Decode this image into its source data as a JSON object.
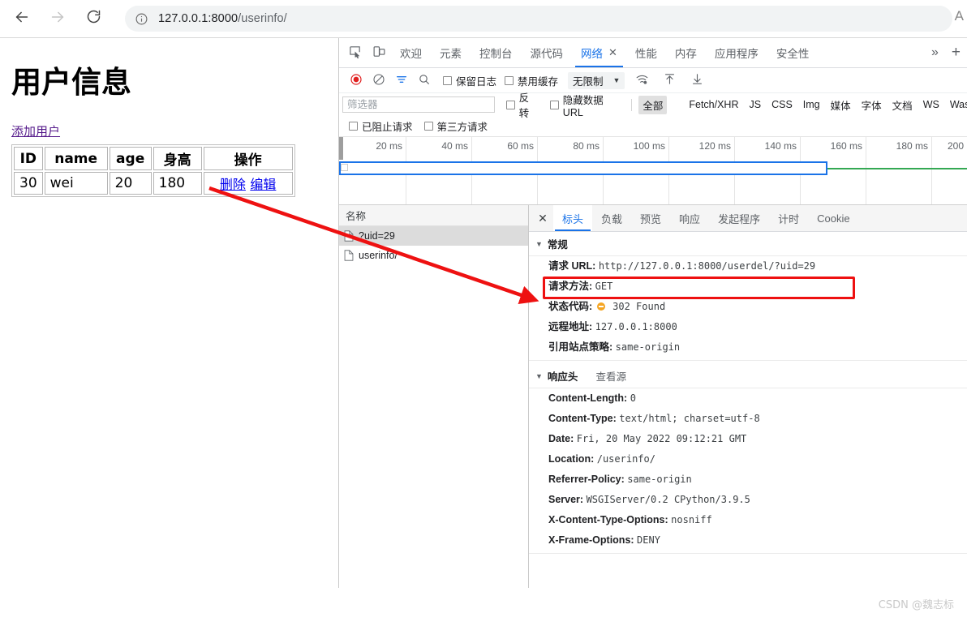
{
  "browser": {
    "back_icon": "arrow-left-icon",
    "forward_icon": "arrow-right-icon",
    "reload_icon": "reload-icon",
    "info_icon": "info-circle-icon",
    "url": "127.0.0.1:8000/userinfo/",
    "url_host": "127.0.0.1:8000",
    "url_path": "/userinfo/",
    "profile_letter": "A"
  },
  "page": {
    "title": "用户信息",
    "add_user_link": "添加用户",
    "table": {
      "headers": [
        "ID",
        "name",
        "age",
        "身高",
        "操作"
      ],
      "rows": [
        {
          "id": "30",
          "name": "wei",
          "age": "20",
          "height": "180",
          "delete": "删除",
          "edit": "编辑"
        }
      ]
    }
  },
  "devtools": {
    "inspect_icon": "inspect-element-icon",
    "device_icon": "device-toolbar-icon",
    "tabs": [
      {
        "label": "欢迎",
        "active": false
      },
      {
        "label": "元素",
        "active": false
      },
      {
        "label": "控制台",
        "active": false
      },
      {
        "label": "源代码",
        "active": false
      },
      {
        "label": "网络",
        "active": true,
        "closable": true
      },
      {
        "label": "性能",
        "active": false
      },
      {
        "label": "内存",
        "active": false
      },
      {
        "label": "应用程序",
        "active": false
      },
      {
        "label": "安全性",
        "active": false
      }
    ],
    "tab_close_glyph": "✕",
    "more_tabs_glyph": "»",
    "add_tab_glyph": "+",
    "toolbar": {
      "record_icon": "record-stop-icon",
      "clear_icon": "clear-icon",
      "filter_icon": "filter-icon",
      "search_icon": "search-icon",
      "preserve_log": "保留日志",
      "disable_cache": "禁用缓存",
      "throttle_value": "无限制",
      "throttle_caret": "▼",
      "wifi_icon": "network-conditions-icon",
      "import_icon": "upload-har-icon",
      "export_icon": "download-har-icon"
    },
    "filter_row": {
      "filter_placeholder": "筛选器",
      "invert": "反转",
      "hide_data_urls": "隐藏数据 URL",
      "types": [
        "全部",
        "Fetch/XHR",
        "JS",
        "CSS",
        "Img",
        "媒体",
        "字体",
        "文档",
        "WS",
        "Was"
      ],
      "active_type": "全部",
      "blocked_requests": "已阻止请求",
      "third_party_requests": "第三方请求"
    },
    "timeline": {
      "ticks": [
        "20 ms",
        "40 ms",
        "60 ms",
        "80 ms",
        "100 ms",
        "120 ms",
        "140 ms",
        "160 ms",
        "180 ms",
        "200"
      ],
      "bar_color": "#0a8f3c",
      "selection_color": "#1a73e8",
      "line_color": "#34a853"
    },
    "request_list": {
      "column_header": "名称",
      "requests": [
        {
          "name": "?uid=29",
          "selected": true
        },
        {
          "name": "userinfo/",
          "selected": false
        }
      ]
    },
    "detail": {
      "close_glyph": "✕",
      "tabs": [
        {
          "label": "标头",
          "active": true
        },
        {
          "label": "负载",
          "active": false
        },
        {
          "label": "预览",
          "active": false
        },
        {
          "label": "响应",
          "active": false
        },
        {
          "label": "发起程序",
          "active": false
        },
        {
          "label": "计时",
          "active": false
        },
        {
          "label": "Cookie",
          "active": false
        }
      ],
      "general": {
        "section_title": "常规",
        "triangle": "▼",
        "rows": [
          {
            "key": "请求 URL:",
            "value": "http://127.0.0.1:8000/userdel/?uid=29",
            "highlighted": true
          },
          {
            "key": "请求方法:",
            "value": "GET"
          },
          {
            "key": "状态代码:",
            "value": "302 Found",
            "status_icon": "status-warning-icon"
          },
          {
            "key": "远程地址:",
            "value": "127.0.0.1:8000"
          },
          {
            "key": "引用站点策略:",
            "value": "same-origin"
          }
        ]
      },
      "response_headers": {
        "section_title": "响应头",
        "triangle": "▼",
        "view_source": "查看源",
        "rows": [
          {
            "key": "Content-Length:",
            "value": "0"
          },
          {
            "key": "Content-Type:",
            "value": "text/html; charset=utf-8"
          },
          {
            "key": "Date:",
            "value": "Fri, 20 May 2022 09:12:21 GMT"
          },
          {
            "key": "Location:",
            "value": "/userinfo/"
          },
          {
            "key": "Referrer-Policy:",
            "value": "same-origin"
          },
          {
            "key": "Server:",
            "value": "WSGIServer/0.2 CPython/3.9.5"
          },
          {
            "key": "X-Content-Type-Options:",
            "value": "nosniff"
          },
          {
            "key": "X-Frame-Options:",
            "value": "DENY"
          }
        ]
      }
    }
  },
  "annotation": {
    "arrow_color": "#ee1111",
    "highlight_color": "#ee1111"
  },
  "watermark": "CSDN @魏志标"
}
